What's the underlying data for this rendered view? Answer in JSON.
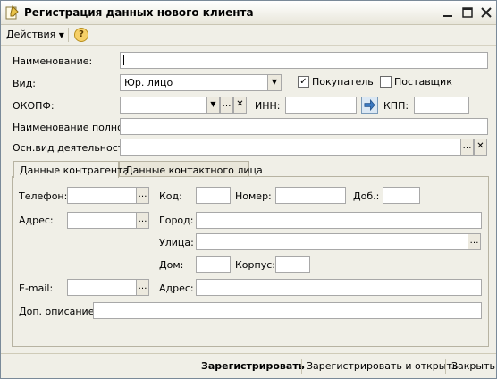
{
  "window": {
    "title": "Регистрация данных нового клиента"
  },
  "toolbar": {
    "actions_label": "Действия",
    "help_label": "?"
  },
  "form": {
    "name_label": "Наименование:",
    "name_value": "",
    "type_label": "Вид:",
    "type_value": "Юр. лицо",
    "buyer_label": "Покупатель",
    "buyer_checked": true,
    "supplier_label": "Поставщик",
    "supplier_checked": false,
    "okopf_label": "ОКОПФ:",
    "okopf_value": "",
    "inn_label": "ИНН:",
    "inn_value": "",
    "kpp_label": "КПП:",
    "kpp_value": "",
    "fullname_label": "Наименование полное:",
    "fullname_value": "",
    "activity_label": "Осн.вид деятельности:",
    "activity_value": ""
  },
  "tabs": [
    {
      "label": "Данные контрагента",
      "active": true
    },
    {
      "label": "Данные контактного лица",
      "active": false
    }
  ],
  "contractor": {
    "phone_label": "Телефон:",
    "code_label": "Код:",
    "number_label": "Номер:",
    "ext_label": "Доб.:",
    "address_label": "Адрес:",
    "city_label": "Город:",
    "street_label": "Улица:",
    "house_label": "Дом:",
    "building_label": "Корпус:",
    "email_label": "E-mail:",
    "address2_label": "Адрес:",
    "extra_label": "Доп. описание:"
  },
  "footer": {
    "register_label": "Зарегистрировать",
    "register_open_label": "Зарегистрировать и открыть",
    "close_label": "Закрыть"
  }
}
